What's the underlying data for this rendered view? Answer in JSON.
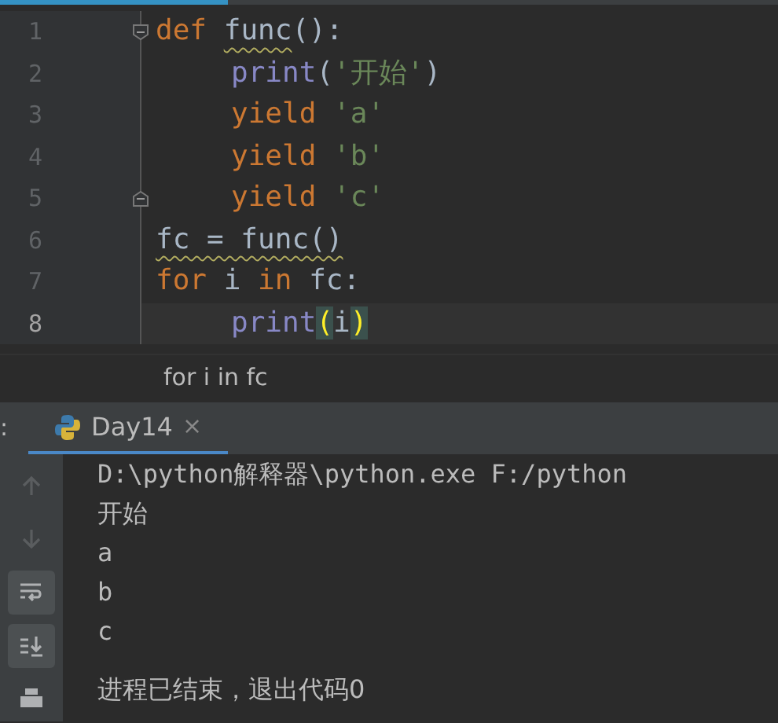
{
  "editor": {
    "lines": [
      {
        "number": "1",
        "indented": false,
        "current": false,
        "fold_start": true,
        "fold_end": false,
        "tokens": [
          {
            "text": "def ",
            "kind": "keyword"
          },
          {
            "text": "func",
            "kind": "plain",
            "warn": true
          },
          {
            "text": "():",
            "kind": "plain"
          }
        ]
      },
      {
        "number": "2",
        "indented": true,
        "current": false,
        "fold_start": false,
        "fold_end": false,
        "tokens": [
          {
            "text": "print",
            "kind": "builtin"
          },
          {
            "text": "(",
            "kind": "plain"
          },
          {
            "text": "'开始'",
            "kind": "string"
          },
          {
            "text": ")",
            "kind": "plain"
          }
        ]
      },
      {
        "number": "3",
        "indented": true,
        "current": false,
        "fold_start": false,
        "fold_end": false,
        "tokens": [
          {
            "text": "yield ",
            "kind": "keyword"
          },
          {
            "text": "'a'",
            "kind": "string"
          }
        ]
      },
      {
        "number": "4",
        "indented": true,
        "current": false,
        "fold_start": false,
        "fold_end": false,
        "tokens": [
          {
            "text": "yield ",
            "kind": "keyword"
          },
          {
            "text": "'b'",
            "kind": "string"
          }
        ]
      },
      {
        "number": "5",
        "indented": true,
        "current": false,
        "fold_start": false,
        "fold_end": true,
        "tokens": [
          {
            "text": "yield ",
            "kind": "keyword"
          },
          {
            "text": "'c'",
            "kind": "string"
          }
        ]
      },
      {
        "number": "6",
        "indented": false,
        "current": false,
        "fold_start": false,
        "fold_end": false,
        "tokens": [
          {
            "text": "fc = func()",
            "kind": "plain",
            "warn": true
          }
        ]
      },
      {
        "number": "7",
        "indented": false,
        "current": false,
        "fold_start": false,
        "fold_end": false,
        "tokens": [
          {
            "text": "for ",
            "kind": "keyword"
          },
          {
            "text": "i ",
            "kind": "plain"
          },
          {
            "text": "in ",
            "kind": "keyword"
          },
          {
            "text": "fc:",
            "kind": "plain"
          }
        ]
      },
      {
        "number": "8",
        "indented": true,
        "current": true,
        "fold_start": false,
        "fold_end": false,
        "tokens": [
          {
            "text": "print",
            "kind": "builtin"
          },
          {
            "text": "(",
            "kind": "match"
          },
          {
            "text": "i",
            "kind": "plain"
          },
          {
            "text": ")",
            "kind": "match"
          }
        ]
      }
    ]
  },
  "breadcrumb": "for i in fc",
  "run_panel": {
    "label": ":",
    "tabs": [
      {
        "label": "Day14",
        "selected": true,
        "close": "×"
      }
    ],
    "toolbar": [
      {
        "kind": "up",
        "disabled": true,
        "toggled": false
      },
      {
        "kind": "down",
        "disabled": true,
        "toggled": false
      },
      {
        "kind": "wrap",
        "disabled": false,
        "toggled": true
      },
      {
        "kind": "scroll-end",
        "disabled": false,
        "toggled": true
      },
      {
        "kind": "print",
        "disabled": false,
        "toggled": false
      }
    ],
    "output": [
      {
        "text": "D:\\python解释器\\python.exe F:/python",
        "blank_before": false
      },
      {
        "text": "开始",
        "blank_before": false
      },
      {
        "text": "a",
        "blank_before": false
      },
      {
        "text": "b",
        "blank_before": false
      },
      {
        "text": "c",
        "blank_before": false
      },
      {
        "text": "进程已结束，退出代码0",
        "blank_before": true
      }
    ]
  }
}
